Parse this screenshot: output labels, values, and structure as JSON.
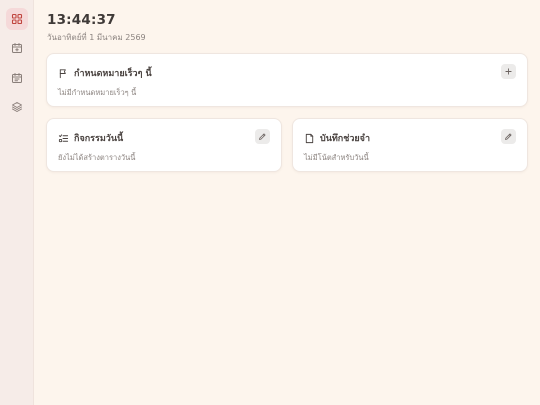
{
  "sidebar": {
    "items": [
      {
        "icon": "dashboard-grid-icon",
        "active": true
      },
      {
        "icon": "calendar-plus-icon",
        "active": false
      },
      {
        "icon": "calendar-icon",
        "active": false
      },
      {
        "icon": "layers-icon",
        "active": false
      }
    ]
  },
  "header": {
    "time": "13:44:37",
    "date": "วันอาทิตย์ที่ 1 มีนาคม 2569"
  },
  "goals": {
    "title": "กำหนดหมายเร็วๆ นี้",
    "empty_text": "ไม่มีกำหนดหมายเร็วๆ นี้"
  },
  "activities": {
    "title": "กิจกรรมวันนี้",
    "empty_text": "ยังไม่ได้สร้างตารางวันนี้"
  },
  "notes": {
    "title": "บันทึกช่วยจำ",
    "empty_text": "ไม่มีโน้ตสำหรับวันนี้"
  },
  "colors": {
    "accent": "#c0453f",
    "background": "#fdf5ed",
    "sidebar": "#f6ece8",
    "active_nav": "#f5d9d9"
  }
}
